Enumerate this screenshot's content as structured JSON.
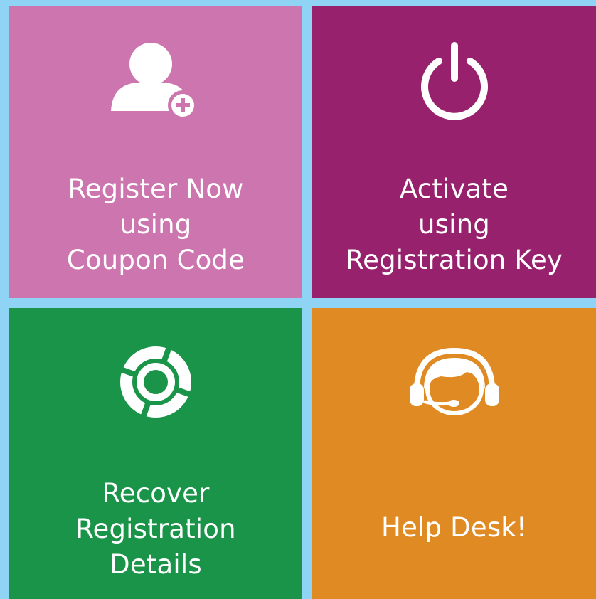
{
  "tiles": {
    "register": {
      "icon": "user-plus-icon",
      "lines": [
        "Register Now",
        "using",
        "Coupon Code"
      ],
      "color": "#cc75ae"
    },
    "activate": {
      "icon": "power-icon",
      "lines": [
        "Activate",
        "using",
        "Registration Key"
      ],
      "color": "#97216c"
    },
    "recover": {
      "icon": "lifebuoy-icon",
      "lines": [
        "Recover",
        "Registration",
        "Details"
      ],
      "color": "#1a9448"
    },
    "help": {
      "icon": "headset-agent-icon",
      "lines": [
        "Help Desk!"
      ],
      "color": "#e08a24"
    }
  },
  "background_color": "#8fd4f4"
}
